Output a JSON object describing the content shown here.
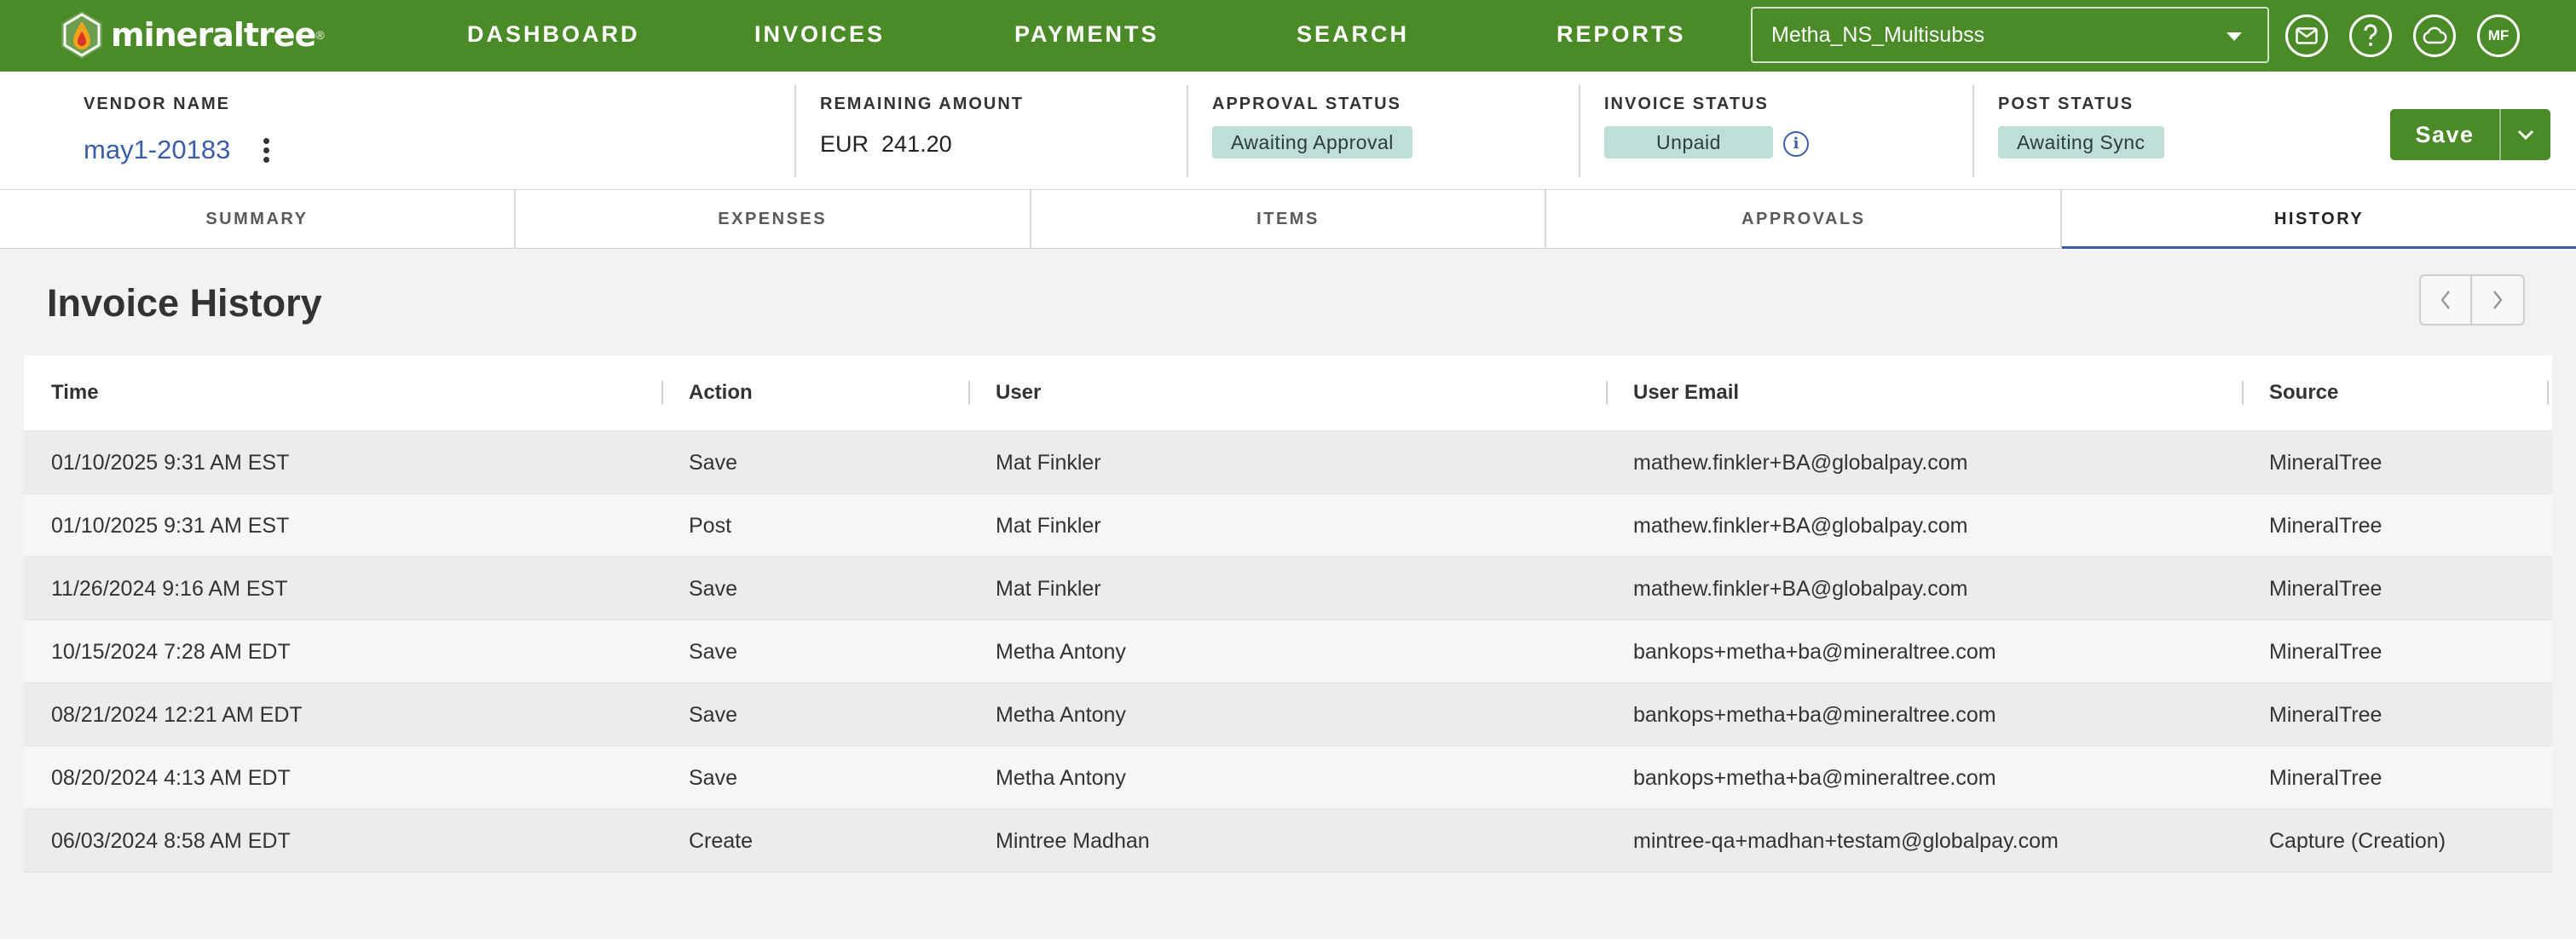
{
  "app": {
    "logo_text": "mineraltree",
    "logo_mark": "®"
  },
  "nav": {
    "items": [
      "DASHBOARD",
      "INVOICES",
      "PAYMENTS",
      "SEARCH",
      "REPORTS"
    ],
    "entity_selector": "Metha_NS_Multisubss",
    "icons": [
      "mail-icon",
      "help-icon",
      "cloud-sync-icon"
    ],
    "avatar_initials": "MF"
  },
  "header": {
    "vendor_label": "VENDOR NAME",
    "vendor_name": "may1-20183",
    "remaining_label": "REMAINING AMOUNT",
    "remaining_currency": "EUR",
    "remaining_value": "241.20",
    "approval_label": "APPROVAL STATUS",
    "approval_status": "Awaiting Approval",
    "invoice_label": "INVOICE STATUS",
    "invoice_status": "Unpaid",
    "post_label": "POST STATUS",
    "post_status": "Awaiting Sync",
    "save_label": "Save"
  },
  "tabs": [
    "SUMMARY",
    "EXPENSES",
    "ITEMS",
    "APPROVALS",
    "HISTORY"
  ],
  "active_tab": "HISTORY",
  "history": {
    "title": "Invoice History",
    "columns": [
      "Time",
      "Action",
      "User",
      "User Email",
      "Source"
    ],
    "rows": [
      [
        "01/10/2025 9:31 AM EST",
        "Save",
        "Mat Finkler",
        "mathew.finkler+BA@globalpay.com",
        "MineralTree"
      ],
      [
        "01/10/2025 9:31 AM EST",
        "Post",
        "Mat Finkler",
        "mathew.finkler+BA@globalpay.com",
        "MineralTree"
      ],
      [
        "11/26/2024 9:16 AM EST",
        "Save",
        "Mat Finkler",
        "mathew.finkler+BA@globalpay.com",
        "MineralTree"
      ],
      [
        "10/15/2024 7:28 AM EDT",
        "Save",
        "Metha Antony",
        "bankops+metha+ba@mineraltree.com",
        "MineralTree"
      ],
      [
        "08/21/2024 12:21 AM EDT",
        "Save",
        "Metha Antony",
        "bankops+metha+ba@mineraltree.com",
        "MineralTree"
      ],
      [
        "08/20/2024 4:13 AM EDT",
        "Save",
        "Metha Antony",
        "bankops+metha+ba@mineraltree.com",
        "MineralTree"
      ],
      [
        "06/03/2024 8:58 AM EDT",
        "Create",
        "Mintree Madhan",
        "mintree-qa+madhan+testam@globalpay.com",
        "Capture (Creation)"
      ]
    ]
  },
  "colors": {
    "brand_green": "#4a8a27",
    "link_blue": "#3b5ea8",
    "badge_teal": "#c0ded8"
  }
}
